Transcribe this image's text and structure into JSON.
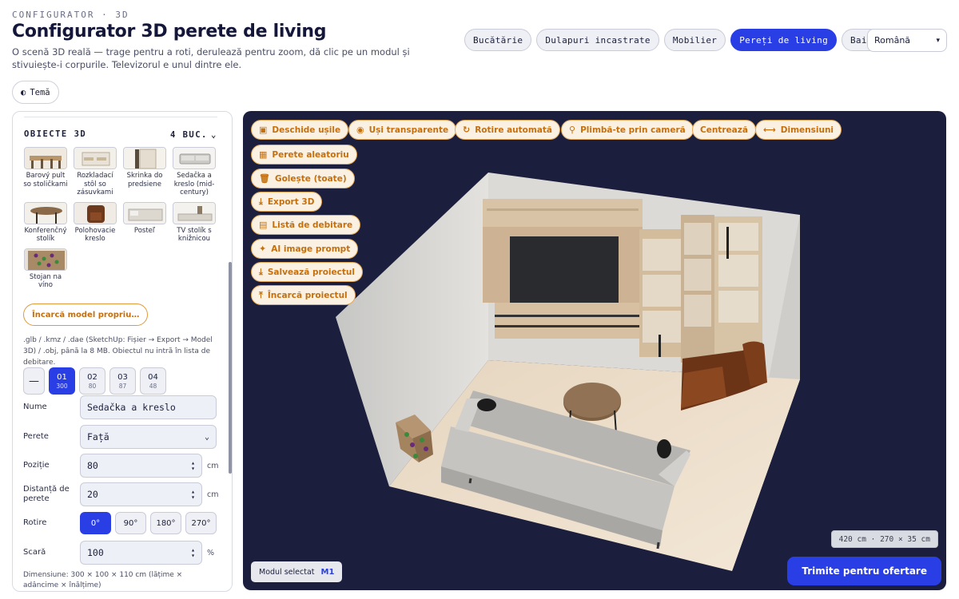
{
  "header": {
    "eyebrow": "CONFIGURATOR · 3D",
    "title": "Configurator 3D perete de living",
    "subtitle": "O scenă 3D reală — trage pentru a roti, derulează pentru zoom, dă clic pe un modul și stivuiește-i corpurile. Televizorul e unul dintre ele.",
    "theme_label": "Temă"
  },
  "nav": {
    "tabs": [
      "Bucătărie",
      "Dulapuri incastrate",
      "Mobilier",
      "Pereți de living",
      "Baie"
    ],
    "active": "Pereți de living",
    "language": "Română"
  },
  "panel": {
    "objects_title": "OBIECTE 3D",
    "objects_count": "4 BUC.",
    "objects": [
      {
        "label": "Barový pult so stoličkami",
        "icon": "bar-counter-thumb"
      },
      {
        "label": "Rozkladací stôl so zásuvkami",
        "icon": "table-thumb"
      },
      {
        "label": "Skrinka do predsiene",
        "icon": "hall-cabinet-thumb"
      },
      {
        "label": "Sedačka a kreslo (mid-century)",
        "icon": "sofa-thumb"
      },
      {
        "label": "Konferenčný stolík",
        "icon": "coffee-table-thumb"
      },
      {
        "label": "Polohovacie kreslo",
        "icon": "armchair-thumb"
      },
      {
        "label": "Posteľ",
        "icon": "bed-thumb"
      },
      {
        "label": "TV stolík s knižnicou",
        "icon": "tv-stand-thumb"
      },
      {
        "label": "Stojan na víno",
        "icon": "wine-rack-thumb"
      }
    ],
    "upload_label": "Încarcă model propriu…",
    "upload_note": ".glb / .kmz / .dae (SketchUp: Fișier → Export → Model 3D) / .obj, până la 8 MB. Obiectul nu intră în lista de debitare.",
    "module_tabs": {
      "minus": "—",
      "items": [
        {
          "num": "01",
          "sub": "300"
        },
        {
          "num": "02",
          "sub": "80"
        },
        {
          "num": "03",
          "sub": "87"
        },
        {
          "num": "04",
          "sub": "48"
        }
      ]
    },
    "fields": {
      "name_label": "Nume",
      "name_value": "Sedačka a kreslo",
      "wall_label": "Perete",
      "wall_value": "Față",
      "position_label": "Poziție",
      "position_value": "80",
      "position_unit": "cm",
      "distance_label": "Distanță de perete",
      "distance_value": "20",
      "distance_unit": "cm",
      "rotation_label": "Rotire",
      "rotations": [
        "0°",
        "90°",
        "180°",
        "270°"
      ],
      "scale_label": "Scară",
      "scale_value": "100",
      "scale_unit": "%"
    },
    "dims_note": "Dimensiune: 300 × 100 × 110 cm (lățime × adâncime × înălțime)"
  },
  "toolbar": {
    "open_doors": "Deschide ușile",
    "transparent_doors": "Uși transparente",
    "auto_rotate": "Rotire automată",
    "walk_camera": "Plimbă-te prin cameră",
    "center": "Centrează",
    "dimensions": "Dimensiuni",
    "random_wall": "Perete aleatoriu",
    "clear_all": "Golește (toate)",
    "export_3d": "Export 3D",
    "cut_list": "Listă de debitare",
    "ai_prompt": "AI image prompt",
    "save_project": "Salvează proiectul",
    "load_project": "Încarcă proiectul"
  },
  "viewport": {
    "room_dims": "420 cm · 270 × 35 cm",
    "selected_label": "Modul selectat",
    "selected_id": "M1",
    "send_offer": "Trimite pentru ofertare"
  },
  "colors": {
    "accent": "#2a3ee6",
    "toolbar_orange": "#c4700f",
    "viewport_bg": "#1b1e3d"
  }
}
